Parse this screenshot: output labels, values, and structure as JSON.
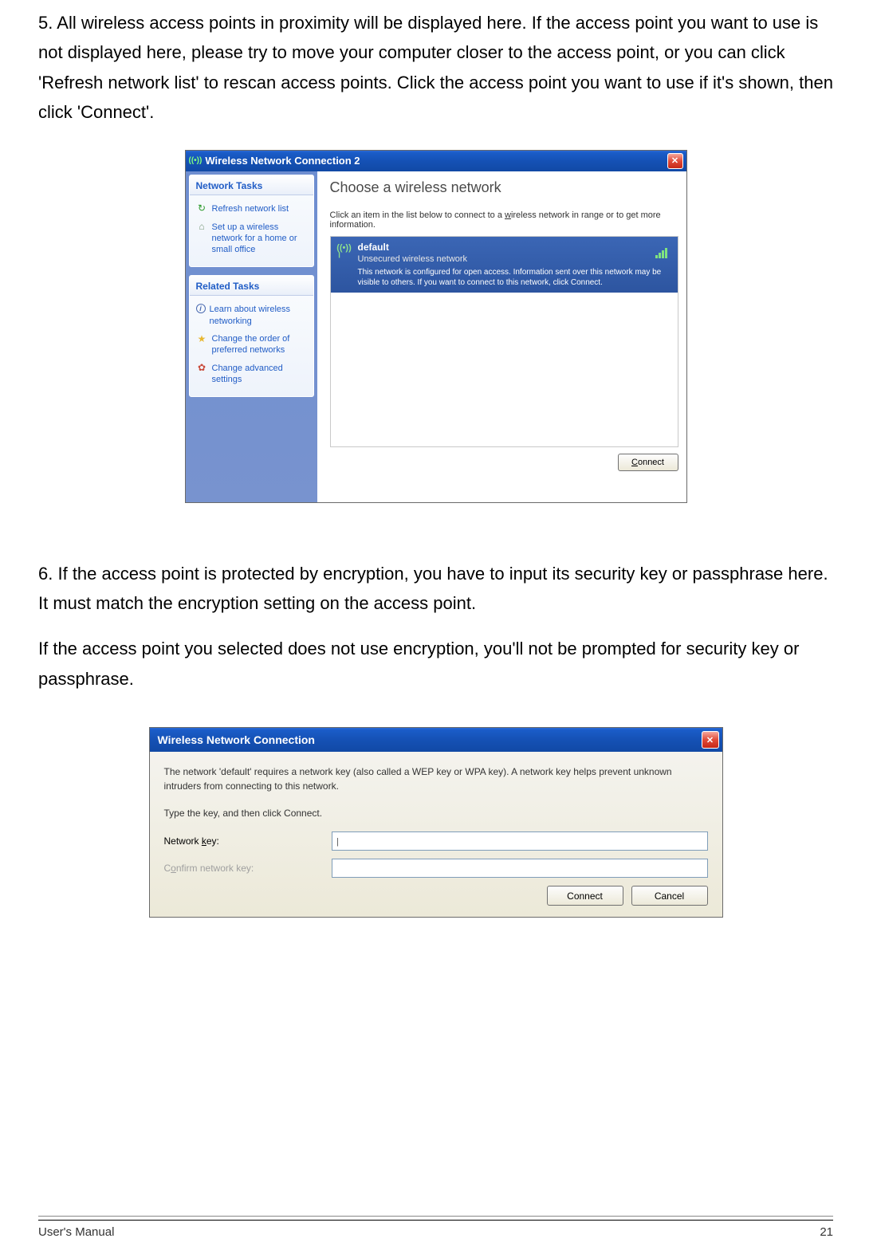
{
  "step5": {
    "num": "5.",
    "text": "All wireless access points in proximity will be displayed here. If the access point you want to use is not displayed here, please try to move your computer closer to the access point, or you can click 'Refresh network list' to rescan access points. Click the access point you want to use if it's shown, then click 'Connect'."
  },
  "step6": {
    "num": "6.",
    "text": "If the access point is protected by encryption, you have to input its security key or passphrase here. It must match the encryption setting on the access point.",
    "text2": "If the access point you selected does not use encryption, you'll not be prompted for security key or passphrase."
  },
  "dialog1": {
    "title": "Wireless Network Connection 2",
    "sidebar": {
      "networkTasksHeader": "Network Tasks",
      "refresh": "Refresh network list",
      "setup": "Set up a wireless network for a home or small office",
      "relatedHeader": "Related Tasks",
      "learn": "Learn about wireless networking",
      "changeOrder": "Change the order of preferred networks",
      "changeAdv": "Change advanced settings"
    },
    "main": {
      "heading": "Choose a wireless network",
      "instruction": "Click an item in the list below to connect to a wireless network in range or to get more information.",
      "network": {
        "name": "default",
        "security": "Unsecured wireless network",
        "desc": "This network is configured for open access. Information sent over this network may be visible to others. If you want to connect to this network, click Connect."
      },
      "connectUnderline": "C",
      "connectRest": "onnect"
    }
  },
  "dialog2": {
    "title": "Wireless Network Connection",
    "text": "The network 'default' requires a network key (also called a WEP key or WPA key). A network key helps prevent unknown intruders from connecting to this network.",
    "text2": "Type the key, and then click Connect.",
    "labelKeyPre": "Network ",
    "labelKeyUl": "k",
    "labelKeyPost": "ey:",
    "labelConfirmPre": "C",
    "labelConfirmUl": "o",
    "labelConfirmPost": "nfirm network key:",
    "btnConnectUl": "C",
    "btnConnectRest": "onnect",
    "btnCancel": "Cancel"
  },
  "footer": {
    "left": "User's Manual",
    "right": "21"
  }
}
